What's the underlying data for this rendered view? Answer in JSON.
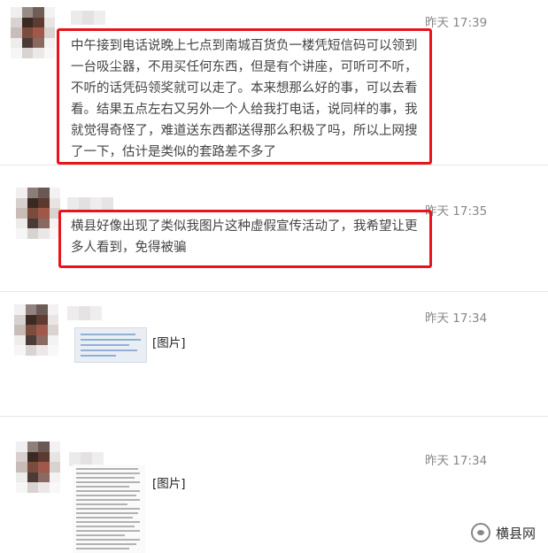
{
  "posts": [
    {
      "time": "昨天 17:39",
      "content": "中午接到电话说晚上七点到南城百货负一楼凭短信码可以领到一台吸尘器，不用买任何东西，但是有个讲座，可听可不听，不听的话凭码领奖就可以走了。本来想那么好的事，可以去看看。结果五点左右又另外一个人给我打电话，说同样的事，我就觉得奇怪了，难道送东西都送得那么积极了吗，所以上网搜了一下，估计是类似的套路差不多了"
    },
    {
      "time": "昨天 17:35",
      "content": "横县好像出现了类似我图片这种虚假宣传活动了，我希望让更多人看到，免得被骗"
    },
    {
      "time": "昨天 17:34",
      "content": "[图片]"
    },
    {
      "time": "昨天 17:34",
      "content": "[图片]"
    }
  ],
  "watermark": {
    "icon": "wechat-icon",
    "text": "横县网"
  },
  "colors": {
    "highlight_border": "#e8141b",
    "time_text": "#888888",
    "divider": "#e6e6e6"
  }
}
